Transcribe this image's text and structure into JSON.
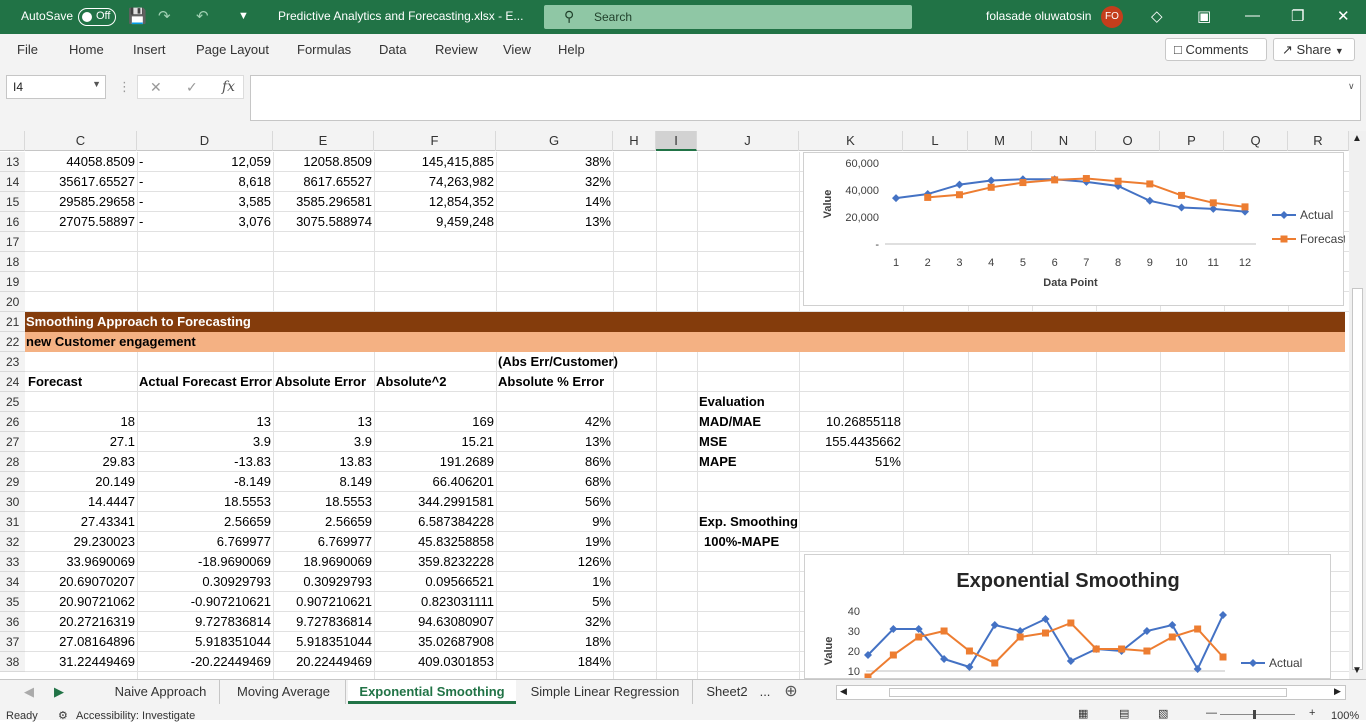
{
  "titlebar": {
    "autosave_label": "AutoSave",
    "autosave_state": "Off",
    "file_title": "Predictive Analytics and Forecasting.xlsx  -  E...",
    "search_placeholder": "Search",
    "user_name": "folasade oluwatosin",
    "user_initials": "FO"
  },
  "menu": {
    "items": [
      "File",
      "Home",
      "Insert",
      "Page Layout",
      "Formulas",
      "Data",
      "Review",
      "View",
      "Help"
    ],
    "comments": "Comments",
    "share": "Share"
  },
  "formula_bar": {
    "name_box": "I4",
    "fx": "fx",
    "content": ""
  },
  "columns": [
    "C",
    "D",
    "E",
    "F",
    "G",
    "H",
    "I",
    "J",
    "K",
    "L",
    "M",
    "N",
    "O",
    "P",
    "Q",
    "R"
  ],
  "rows": [
    "13",
    "14",
    "15",
    "16",
    "17",
    "18",
    "19",
    "20",
    "21",
    "22",
    "23",
    "24",
    "25",
    "26",
    "27",
    "28",
    "29",
    "30",
    "31",
    "32",
    "33",
    "34",
    "35",
    "36",
    "37",
    "38"
  ],
  "top_table": [
    [
      "44058.8509",
      "-",
      "12,059",
      "12058.8509",
      "145,415,885",
      "38%"
    ],
    [
      "35617.65527",
      "-",
      "8,618",
      "8617.65527",
      "74,263,982",
      "32%"
    ],
    [
      "29585.29658",
      "-",
      "3,585",
      "3585.296581",
      "12,854,352",
      "14%"
    ],
    [
      "27075.58897",
      "-",
      "3,076",
      "3075.588974",
      "9,459,248",
      "13%"
    ]
  ],
  "section": {
    "title": "Smoothing Approach to Forecasting",
    "subtitle": "new Customer engagement"
  },
  "headers": {
    "g23": "(Abs Err/Customer)",
    "c24": "Forecast",
    "d24": "Actual Forecast Error",
    "e24": "Absolute Error",
    "f24": "Absolute^2",
    "g24": "Absolute % Error"
  },
  "smoothing_table": [
    [
      "18",
      "13",
      "13",
      "169",
      "42%"
    ],
    [
      "27.1",
      "3.9",
      "3.9",
      "15.21",
      "13%"
    ],
    [
      "29.83",
      "-13.83",
      "13.83",
      "191.2689",
      "86%"
    ],
    [
      "20.149",
      "-8.149",
      "8.149",
      "66.406201",
      "68%"
    ],
    [
      "14.4447",
      "18.5553",
      "18.5553",
      "344.2991581",
      "56%"
    ],
    [
      "27.43341",
      "2.56659",
      "2.56659",
      "6.587384228",
      "9%"
    ],
    [
      "29.230023",
      "6.769977",
      "6.769977",
      "45.83258858",
      "19%"
    ],
    [
      "33.9690069",
      "-18.9690069",
      "18.9690069",
      "359.8232228",
      "126%"
    ],
    [
      "20.69070207",
      "0.30929793",
      "0.30929793",
      "0.09566521",
      "1%"
    ],
    [
      "20.90721062",
      "-0.907210621",
      "0.907210621",
      "0.823031111",
      "5%"
    ],
    [
      "20.27216319",
      "9.727836814",
      "9.727836814",
      "94.63080907",
      "32%"
    ],
    [
      "27.08164896",
      "5.918351044",
      "5.918351044",
      "35.02687908",
      "18%"
    ],
    [
      "31.22449469",
      "-20.22449469",
      "20.22449469",
      "409.0301853",
      "184%"
    ]
  ],
  "evaluation": {
    "title": "Evaluation",
    "labels": [
      "MAD/MAE",
      "MSE",
      "MAPE"
    ],
    "values": [
      "10.26855118",
      "155.4435662",
      "51%"
    ],
    "exp_smoothing": "Exp. Smoothing",
    "accuracy": "100%-MAPE"
  },
  "chart_data": [
    {
      "type": "line",
      "title": "",
      "xlabel": "Data Point",
      "ylabel": "Value",
      "x": [
        1,
        2,
        3,
        4,
        5,
        6,
        7,
        8,
        9,
        10,
        11,
        12
      ],
      "y_ticks": [
        "60,000",
        "40,000",
        "20,000",
        "-"
      ],
      "ylim": [
        0,
        60000
      ],
      "legend_position": "right",
      "series": [
        {
          "name": "Actual",
          "color": "#4472c4",
          "marker": "diamond",
          "values": [
            34000,
            37000,
            44000,
            47000,
            48000,
            48000,
            46000,
            43000,
            32000,
            27000,
            26000,
            24000
          ]
        },
        {
          "name": "Forecast",
          "color": "#ed7d31",
          "marker": "square",
          "values": [
            null,
            34500,
            36500,
            42000,
            45500,
            47500,
            48500,
            46500,
            44500,
            36000,
            30500,
            27500
          ]
        }
      ]
    },
    {
      "type": "line",
      "title": "Exponential Smoothing",
      "xlabel": "",
      "ylabel": "Value",
      "y_ticks": [
        "40",
        "30",
        "20",
        "10"
      ],
      "ylim": [
        10,
        40
      ],
      "legend_position": "right",
      "series": [
        {
          "name": "Actual",
          "color": "#4472c4",
          "marker": "diamond",
          "values": [
            18,
            31,
            31,
            16,
            12,
            33,
            30,
            36,
            15,
            21,
            20,
            30,
            33,
            11,
            38
          ]
        },
        {
          "name": "",
          "color": "#ed7d31",
          "marker": "square",
          "values": [
            7,
            18,
            27,
            30,
            20,
            14,
            27,
            29,
            34,
            21,
            21,
            20,
            27,
            31,
            17
          ]
        }
      ]
    }
  ],
  "sheet_tabs": [
    "Naive Approach",
    "Moving Average",
    "Exponential Smoothing",
    "Simple Linear Regression",
    "Sheet2"
  ],
  "active_tab": "Exponential Smoothing",
  "tabs_more": "...",
  "status": {
    "ready": "Ready",
    "accessibility": "Accessibility: Investigate",
    "zoom": "100%"
  }
}
